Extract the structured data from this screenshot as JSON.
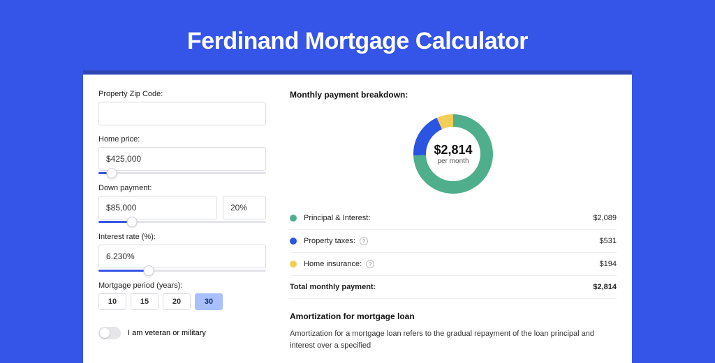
{
  "title": "Ferdinand Mortgage Calculator",
  "form": {
    "zip_label": "Property Zip Code:",
    "zip_value": "",
    "price_label": "Home price:",
    "price_value": "$425,000",
    "price_fill_pct": 8,
    "down_label": "Down payment:",
    "down_value": "$85,000",
    "down_pct": "20%",
    "down_fill_pct": 20,
    "rate_label": "Interest rate (%):",
    "rate_value": "6.230%",
    "rate_fill_pct": 30,
    "period_label": "Mortgage period (years):",
    "periods": {
      "0": "10",
      "1": "15",
      "2": "20",
      "3": "30"
    },
    "period_selected_index": 3,
    "veteran_label": "I am veteran or military"
  },
  "breakdown": {
    "title": "Monthly payment breakdown:",
    "center_value": "$2,814",
    "center_label": "per month",
    "rows": [
      {
        "name": "Principal & Interest:",
        "value": "$2,089",
        "color": "#4fae8b",
        "info": false
      },
      {
        "name": "Property taxes:",
        "value": "$531",
        "color": "#2a54e1",
        "info": true
      },
      {
        "name": "Home insurance:",
        "value": "$194",
        "color": "#f3cd5a",
        "info": true
      }
    ],
    "total_label": "Total monthly payment:",
    "total_value": "$2,814"
  },
  "chart_data": {
    "type": "pie",
    "title": "Monthly payment breakdown",
    "series": [
      {
        "name": "Principal & Interest",
        "value": 2089,
        "color": "#4fae8b"
      },
      {
        "name": "Property taxes",
        "value": 531,
        "color": "#2a54e1"
      },
      {
        "name": "Home insurance",
        "value": 194,
        "color": "#f3cd5a"
      }
    ],
    "total": 2814
  },
  "amort": {
    "heading": "Amortization for mortgage loan",
    "text": "Amortization for a mortgage loan refers to the gradual repayment of the loan principal and interest over a specified"
  },
  "icons": {
    "info_glyph": "?"
  }
}
